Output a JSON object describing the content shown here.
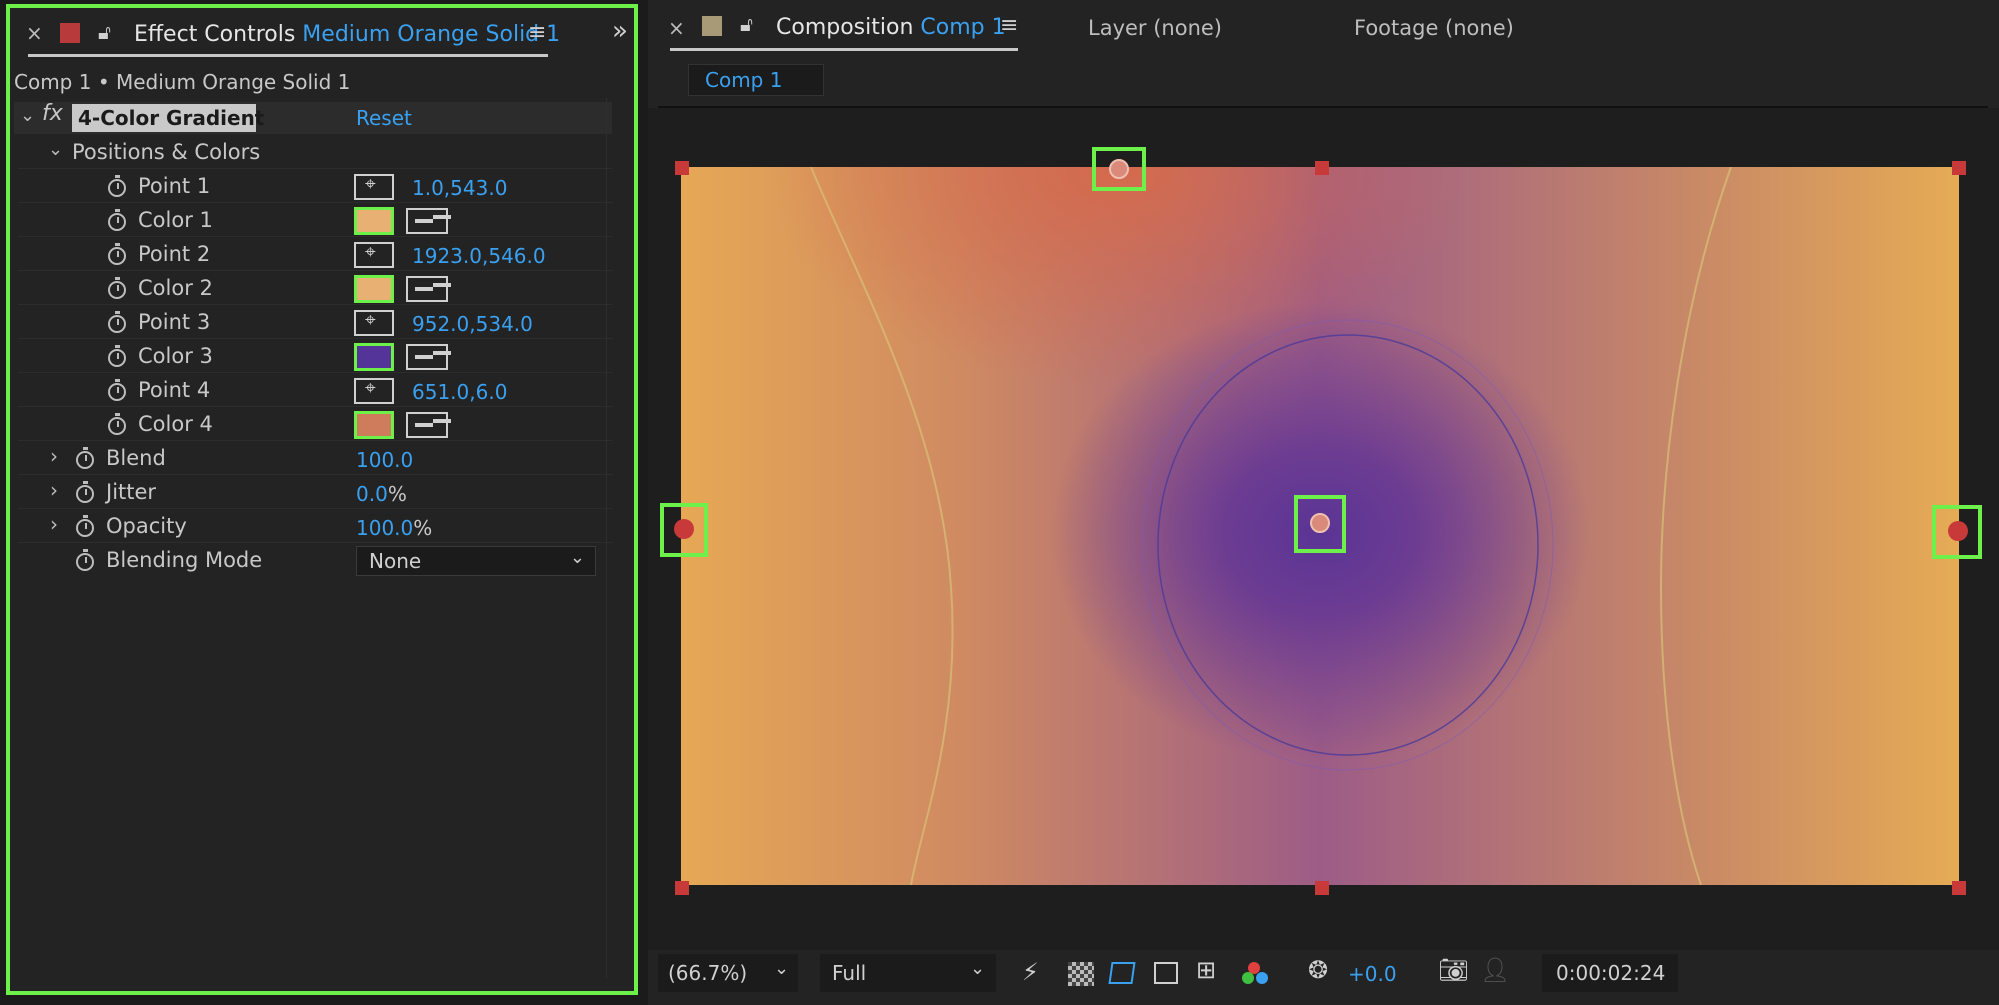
{
  "effect_controls": {
    "close": "×",
    "tab_label": "Effect Controls",
    "layer_name": "Medium Orange Solid 1",
    "menu": "≡",
    "expand": "»",
    "breadcrumb": "Comp 1 • Medium Orange Solid 1",
    "fx_label": "fx",
    "effect_name": "4-Color Gradient",
    "reset_label": "Reset",
    "group_label": "Positions & Colors",
    "rows": [
      {
        "label": "Point 1",
        "value": "1.0,543.0"
      },
      {
        "label": "Color 1",
        "swatch": "#e8b073"
      },
      {
        "label": "Point 2",
        "value": "1923.0,546.0"
      },
      {
        "label": "Color 2",
        "swatch": "#e8b073"
      },
      {
        "label": "Point 3",
        "value": "952.0,534.0"
      },
      {
        "label": "Color 3",
        "swatch": "#55349a"
      },
      {
        "label": "Point 4",
        "value": "651.0,6.0"
      },
      {
        "label": "Color 4",
        "swatch": "#cf7c5c"
      }
    ],
    "blend": {
      "label": "Blend",
      "value": "100.0"
    },
    "jitter": {
      "label": "Jitter",
      "value": "0.0",
      "unit": "%"
    },
    "opacity": {
      "label": "Opacity",
      "value": "100.0",
      "unit": "%"
    },
    "blending_mode": {
      "label": "Blending Mode",
      "value": "None"
    }
  },
  "composition": {
    "close": "×",
    "tab_label": "Composition",
    "comp_name": "Comp 1",
    "menu": "≡",
    "layer_tab": "Layer (none)",
    "footage_tab": "Footage (none)",
    "subtab": "Comp 1"
  },
  "bottom_bar": {
    "zoom": "(66.7%)",
    "resolution": "Full",
    "exposure": "+0.0",
    "timecode": "0:00:02:24"
  },
  "colors": {
    "accent": "#3aa0f0",
    "highlight": "#6ef04a",
    "handle": "#c83a3a"
  }
}
